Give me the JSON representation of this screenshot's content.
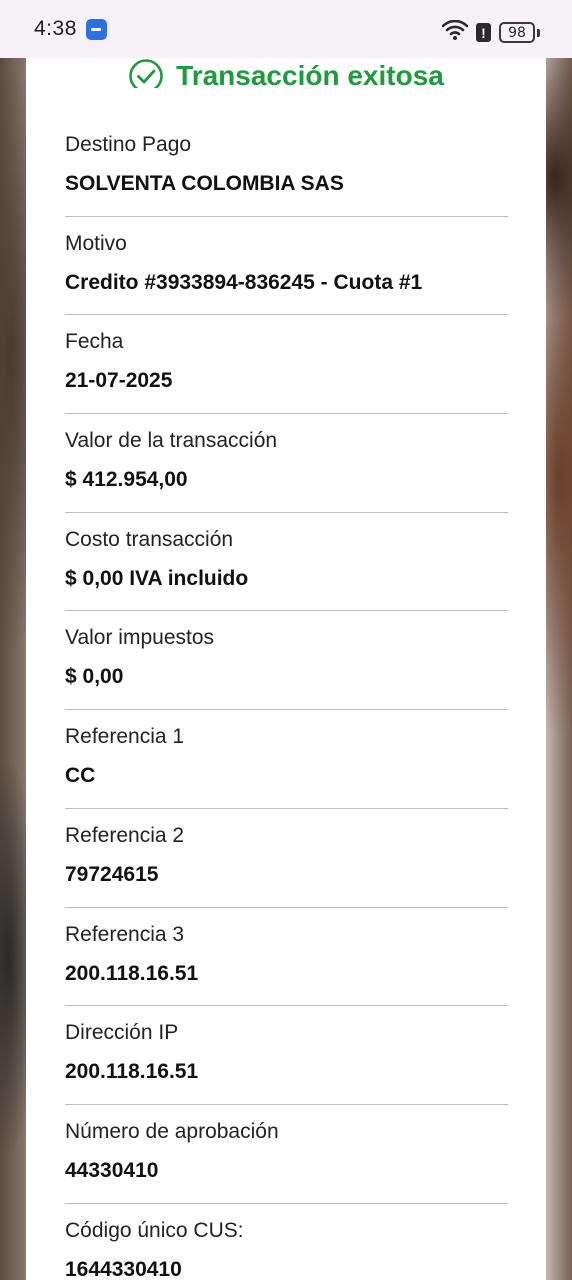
{
  "status_bar": {
    "time": "4:38",
    "battery": "98"
  },
  "header": {
    "title": "Transacción exitosa",
    "accent_color": "#1f9b3e"
  },
  "details": [
    {
      "label": "Destino Pago",
      "value": "SOLVENTA COLOMBIA SAS"
    },
    {
      "label": "Motivo",
      "value": "Credito #3933894-836245 - Cuota #1"
    },
    {
      "label": "Fecha",
      "value": "21-07-2025"
    },
    {
      "label": "Valor de la transacción",
      "value": "$ 412.954,00"
    },
    {
      "label": "Costo transacción",
      "value": "$ 0,00 IVA incluido"
    },
    {
      "label": "Valor impuestos",
      "value": "$ 0,00"
    },
    {
      "label": "Referencia 1",
      "value": "CC"
    },
    {
      "label": "Referencia 2",
      "value": "79724615"
    },
    {
      "label": "Referencia 3",
      "value": "200.118.16.51"
    },
    {
      "label": "Dirección IP",
      "value": "200.118.16.51"
    },
    {
      "label": "Número de aprobación",
      "value": "44330410"
    },
    {
      "label": "Código único CUS:",
      "value": "1644330410"
    }
  ]
}
